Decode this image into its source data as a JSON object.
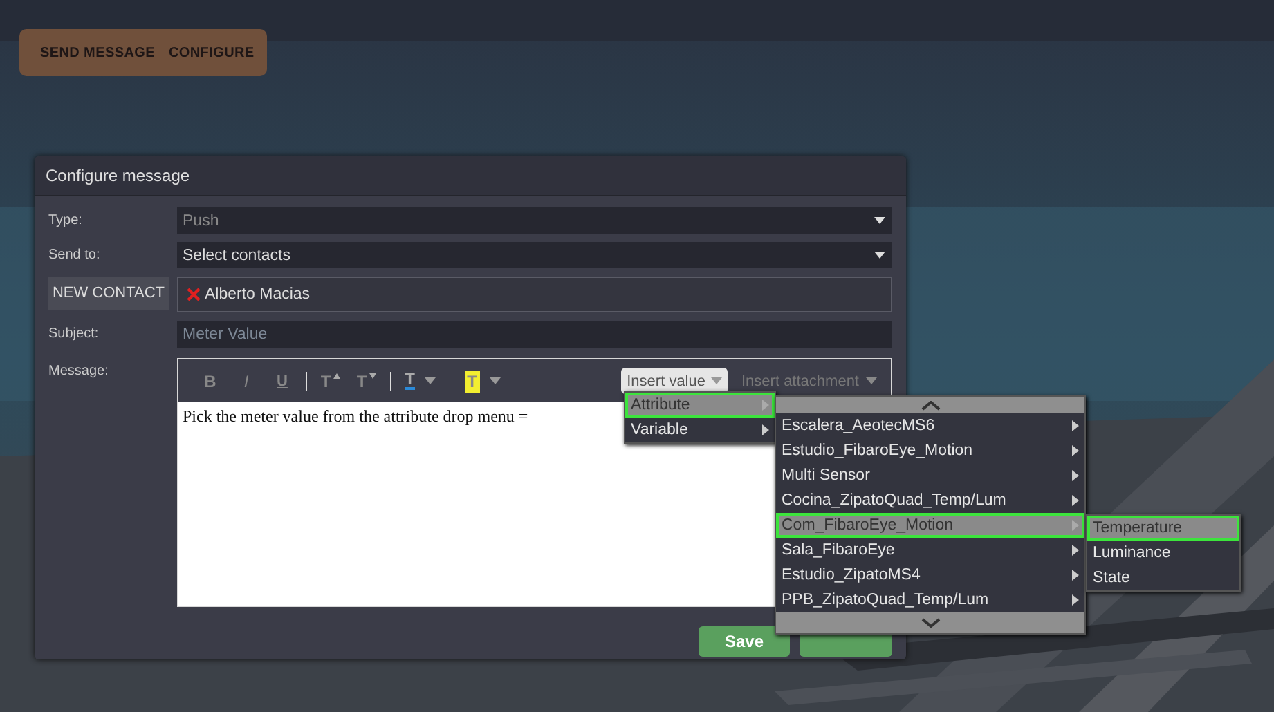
{
  "block": {
    "parts": [
      "SEND MESSAGE",
      "CONFIGURE"
    ]
  },
  "dialog": {
    "title": "Configure message",
    "fields": [
      {
        "kind": "select",
        "label": "Type:",
        "value": "Push",
        "dim": true
      },
      {
        "kind": "select",
        "label": "Send to:",
        "value": "Select contacts",
        "dim": false
      },
      {
        "kind": "contacts",
        "button": "NEW CONTACT",
        "contacts": [
          "Alberto Macias"
        ]
      },
      {
        "kind": "text",
        "label": "Subject:",
        "placeholder": "Meter Value"
      },
      {
        "kind": "editor",
        "label": "Message:"
      }
    ],
    "toolbar": [
      {
        "kind": "bold",
        "glyph": "B"
      },
      {
        "kind": "italic",
        "glyph": "I"
      },
      {
        "kind": "underline",
        "glyph": "U"
      },
      {
        "kind": "sep"
      },
      {
        "kind": "grow",
        "glyph": "T"
      },
      {
        "kind": "shrink",
        "glyph": "T"
      },
      {
        "kind": "sep"
      },
      {
        "kind": "color",
        "glyph": "T"
      },
      {
        "kind": "highlight",
        "glyph": "T"
      }
    ],
    "insert_value": {
      "label": "Insert value",
      "disabled": false
    },
    "insert_attachment": {
      "label": "Insert attachment",
      "disabled": true
    },
    "body": "Pick the meter value from the attribute drop menu =",
    "save": "Save"
  },
  "insert_menu": [
    {
      "label": "Attribute",
      "selected": true
    },
    {
      "label": "Variable",
      "selected": false
    }
  ],
  "device_menu": [
    {
      "label": "Escalera_AeotecMS6",
      "selected": false
    },
    {
      "label": "Estudio_FibaroEye_Motion",
      "selected": false
    },
    {
      "label": "Multi Sensor",
      "selected": false
    },
    {
      "label": "Cocina_ZipatoQuad_Temp/Lum",
      "selected": false
    },
    {
      "label": "Com_FibaroEye_Motion",
      "selected": true
    },
    {
      "label": "Sala_FibaroEye",
      "selected": false
    },
    {
      "label": "Estudio_ZipatoMS4",
      "selected": false
    },
    {
      "label": "PPB_ZipatoQuad_Temp/Lum",
      "selected": false
    }
  ],
  "attribute_menu": [
    {
      "label": "Temperature",
      "selected": true
    },
    {
      "label": "Luminance",
      "selected": false
    },
    {
      "label": "State",
      "selected": false
    }
  ]
}
